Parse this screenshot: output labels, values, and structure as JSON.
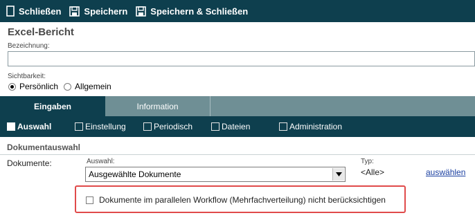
{
  "toolbar": {
    "close_label": "Schließen",
    "save_label": "Speichern",
    "save_close_label": "Speichern & Schließen"
  },
  "page": {
    "title": "Excel-Bericht",
    "designation_label": "Bezeichnung:",
    "designation_value": "",
    "visibility_label": "Sichtbarkeit:",
    "visibility_options": [
      "Persönlich",
      "Allgemein"
    ],
    "visibility_selected": "Persönlich"
  },
  "tabs": [
    {
      "label": "Eingaben",
      "active": true
    },
    {
      "label": "Information",
      "active": false
    }
  ],
  "subnav": [
    {
      "label": "Auswahl",
      "active": true
    },
    {
      "label": "Einstellung",
      "active": false
    },
    {
      "label": "Periodisch",
      "active": false
    },
    {
      "label": "Dateien",
      "active": false
    },
    {
      "label": "Administration",
      "active": false
    }
  ],
  "section": {
    "title": "Dokumentauswahl",
    "documents_label": "Dokumente:",
    "selection_label": "Auswahl:",
    "selection_value": "Ausgewählte Dokumente",
    "type_label": "Typ:",
    "type_value": "<Alle>",
    "select_link": "auswählen",
    "ignore_parallel_label": "Dokumente im parallelen Workflow (Mehrfachverteilung) nicht berücksichtigen"
  },
  "colors": {
    "toolbar_bg": "#0e3f4e",
    "tab_inactive_bg": "#6f8f95",
    "highlight_border": "#e04a4a",
    "link": "#1a3fa0"
  }
}
